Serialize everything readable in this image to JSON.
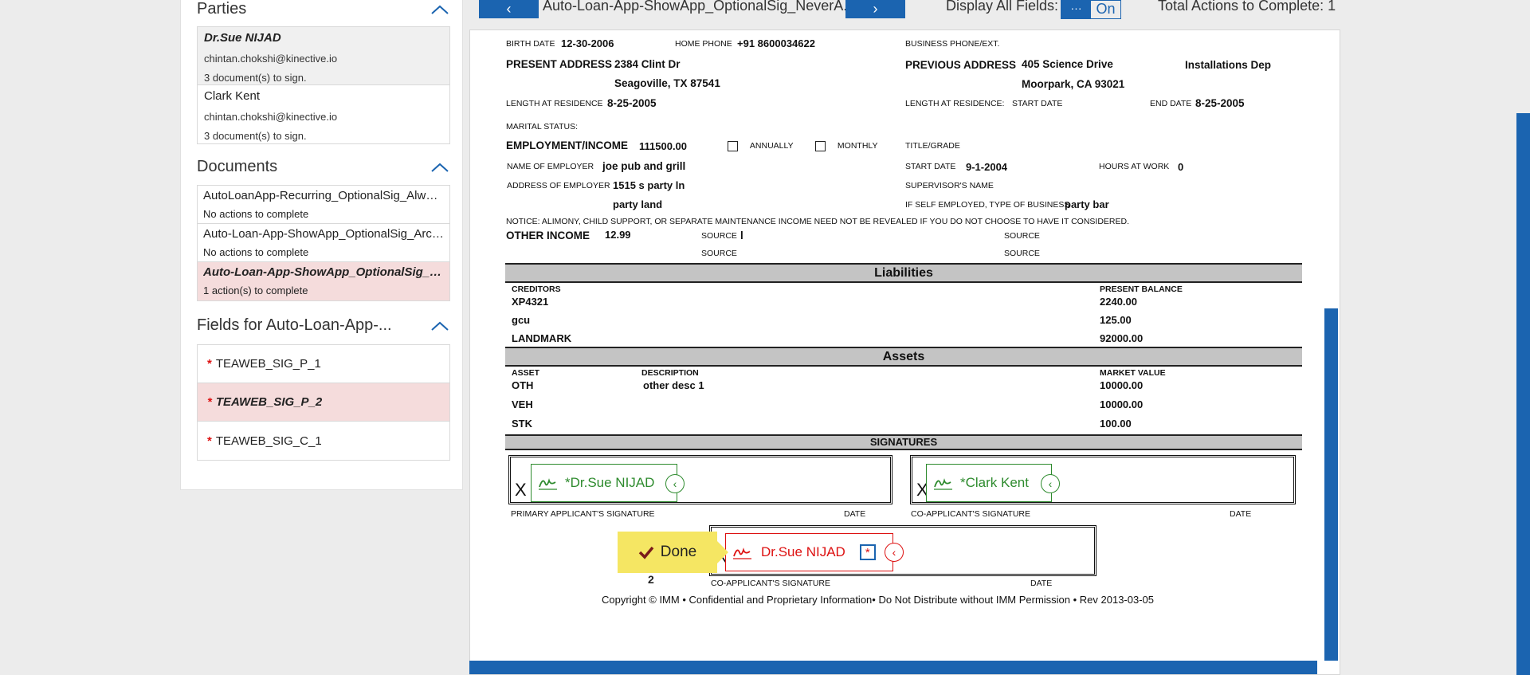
{
  "sidebar": {
    "parties_title": "Parties",
    "parties": [
      {
        "name": "Dr.Sue NIJAD",
        "email": "chintan.chokshi@kinective.io",
        "status": "3 document(s) to sign."
      },
      {
        "name": "Clark Kent",
        "email": "chintan.chokshi@kinective.io",
        "status": "3 document(s) to sign."
      }
    ],
    "documents_title": "Documents",
    "documents": [
      {
        "name": "AutoLoanApp-Recurring_OptionalSig_Always",
        "status": "No actions to complete"
      },
      {
        "name": "Auto-Loan-App-ShowApp_OptionalSig_Archive",
        "status": "No actions to complete"
      },
      {
        "name": "Auto-Loan-App-ShowApp_OptionalSig_NeverArchive",
        "status": "1 action(s) to complete"
      }
    ],
    "fields_title": "Fields for Auto-Loan-App-...",
    "fields": [
      "TEAWEB_SIG_P_1",
      "TEAWEB_SIG_P_2",
      "TEAWEB_SIG_C_1"
    ],
    "required_mark": "*"
  },
  "topbar": {
    "prev": "‹",
    "doc_title": "Auto-Loan-App-ShowApp_OptionalSig_NeverA...",
    "next": "›",
    "display_all_label": "Display All Fields:",
    "toggle_dots": "···",
    "toggle_value": "On",
    "total_actions": "Total Actions to Complete: 1"
  },
  "form": {
    "birth_date_label": "BIRTH DATE",
    "birth_date": "12-30-2006",
    "home_phone_label": "HOME PHONE",
    "home_phone": "+91 8600034622",
    "business_phone_label": "BUSINESS PHONE/EXT.",
    "present_address_label": "PRESENT ADDRESS",
    "present_address_1": "2384 Clint Dr",
    "present_address_2": "Seagoville, TX 87541",
    "previous_address_label": "PREVIOUS ADDRESS",
    "previous_address_1": "405 Science Drive",
    "previous_address_2": "Moorpark, CA 93021",
    "previous_extra": "Installations Dep",
    "length_res_label": "LENGTH AT RESIDENCE",
    "length_res": "8-25-2005",
    "length_res2_label": "LENGTH AT RESIDENCE:",
    "start_date_label": "START DATE",
    "end_date_label": "END DATE",
    "end_date": "8-25-2005",
    "marital_label": "MARITAL STATUS:",
    "employment_label": "EMPLOYMENT/INCOME",
    "employment_income": "111500.00",
    "annually": "ANNUALLY",
    "monthly": "MONTHLY",
    "title_grade": "TITLE/GRADE",
    "employer_label": "NAME OF EMPLOYER",
    "employer": "joe pub and grill",
    "start_date2_label": "START DATE",
    "start_date2": "9-1-2004",
    "hours_label": "HOURS AT WORK",
    "hours": "0",
    "employer_addr_label": "ADDRESS OF EMPLOYER",
    "employer_addr_1": "1515 s party ln",
    "employer_addr_2": "party land",
    "supervisor_label": "SUPERVISOR'S NAME",
    "self_employed_label": "IF SELF EMPLOYED, TYPE OF BUSINESS",
    "self_employed": "party bar",
    "notice": "NOTICE: ALIMONY, CHILD SUPPORT, OR SEPARATE MAINTENANCE INCOME NEED NOT BE REVEALED IF YOU DO NOT CHOOSE TO HAVE IT CONSIDERED.",
    "other_income_label": "OTHER INCOME",
    "other_income": "12.99",
    "source_label": "SOURCE",
    "source_value": "l",
    "liabilities_title": "Liabilities",
    "creditors_label": "CREDITORS",
    "present_balance_label": "PRESENT BALANCE",
    "liabilities": [
      {
        "creditor": "XP4321",
        "balance": "2240.00"
      },
      {
        "creditor": "gcu",
        "balance": "125.00"
      },
      {
        "creditor": "LANDMARK",
        "balance": "92000.00"
      }
    ],
    "assets_title": "Assets",
    "asset_label": "ASSET",
    "description_label": "DESCRIPTION",
    "market_value_label": "MARKET VALUE",
    "assets": [
      {
        "asset": "OTH",
        "description": "other desc 1",
        "value": "10000.00"
      },
      {
        "asset": "VEH",
        "description": "",
        "value": "10000.00"
      },
      {
        "asset": "STK",
        "description": "",
        "value": "100.00"
      }
    ],
    "signatures_title": "SIGNATURES",
    "x_mark": "X",
    "primary_sig_label": "PRIMARY APPLICANT'S SIGNATURE",
    "co_sig_label": "CO-APPLICANT'S SIGNATURE",
    "date_label": "DATE",
    "sig1_name": "*Dr.Sue NIJAD",
    "sig2_name": "*Clark Kent",
    "sig3_name": "Dr.Sue NIJAD",
    "sig3_req": "*",
    "done_label": "Done",
    "done_count": "2",
    "copyright": "Copyright © IMM • Confidential and Proprietary Information• Do Not Distribute without IMM Permission • Rev 2013-03-05"
  },
  "colors": {
    "accent": "#1b64b0",
    "sig_green": "#2e8b2e",
    "sig_red": "#dd1111",
    "done_yellow": "#f5e663",
    "selected_pink": "#f5dcdc"
  }
}
